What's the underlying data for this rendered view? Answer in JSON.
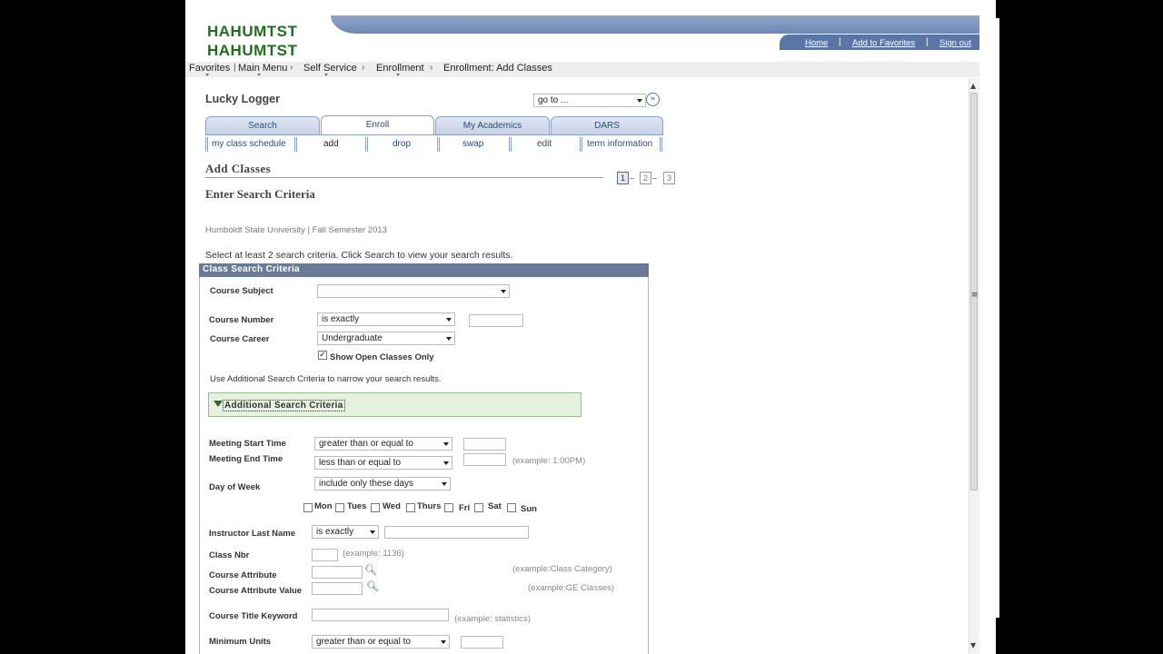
{
  "header": {
    "logo_line1": "HAHUMTST",
    "logo_line2": "HAHUMTST",
    "links": [
      "Home",
      "Add to Favorites",
      "Sign out"
    ]
  },
  "breadcrumb": [
    "Favorites",
    "Main Menu",
    "Self Service",
    "Enrollment",
    "Enrollment: Add Classes"
  ],
  "student_name": "Lucky Logger",
  "goto": {
    "value": "go to ...",
    "button": "»"
  },
  "tabs": [
    "Search",
    "Enroll",
    "My Academics",
    "DARS"
  ],
  "active_tab": "Enroll",
  "subtabs": [
    "my class schedule",
    "add",
    "drop",
    "swap",
    "edit",
    "term information"
  ],
  "page_title": "Add Classes",
  "steps": [
    "1",
    "2",
    "3"
  ],
  "section_title": "Enter Search Criteria",
  "term": "Humboldt State University | Fall Semester 2013",
  "instructions": "Select at least 2 search criteria. Click Search to view your search results.",
  "panel_title": "Class Search Criteria",
  "form": {
    "course_subject": {
      "label": "Course Subject",
      "value": ""
    },
    "course_number": {
      "label": "Course Number",
      "operator": "is exactly"
    },
    "course_career": {
      "label": "Course Career",
      "value": "Undergraduate"
    },
    "open_only": {
      "label": "Show Open Classes Only",
      "checked": true,
      "mark": "✓"
    },
    "additional_note": "Use Additional Search Criteria to narrow your search results.",
    "additional_header": "Additional Search Criteria",
    "meeting_start": {
      "label": "Meeting Start Time",
      "operator": "greater than or equal to"
    },
    "meeting_end": {
      "label": "Meeting End Time",
      "operator": "less than or equal to",
      "hint": "(example: 1:00PM)"
    },
    "day_of_week": {
      "label": "Day of Week",
      "operator": "include only these days"
    },
    "days": [
      "Mon",
      "Tues",
      "Wed",
      "Thurs",
      "Fri",
      "Sat",
      "Sun"
    ],
    "instructor": {
      "label": "Instructor Last Name",
      "operator": "is exactly"
    },
    "class_nbr": {
      "label": "Class Nbr",
      "hint": "(example: 1136)"
    },
    "course_attribute": {
      "label": "Course Attribute",
      "hint": "(example:Class Category)"
    },
    "course_attribute_value": {
      "label": "Course Attribute Value",
      "hint": "(example:GE Classes)"
    },
    "title_keyword": {
      "label": "Course Title Keyword",
      "hint": "(example: statistics)"
    },
    "min_units": {
      "label": "Minimum Units",
      "operator": "greater than or equal to"
    }
  }
}
